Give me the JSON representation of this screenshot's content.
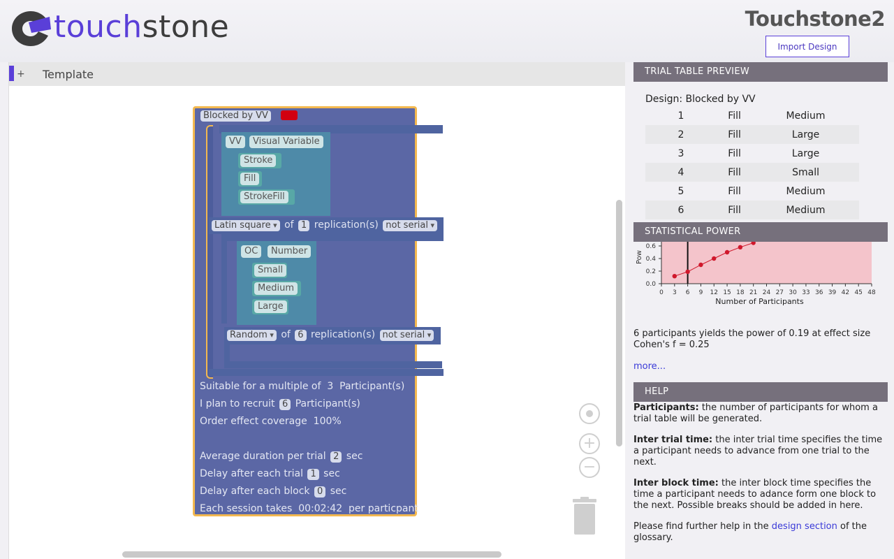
{
  "header": {
    "logo_text_a": "touch",
    "logo_text_b": "stone",
    "app_title": "Touchstone2",
    "import_button": "Import Design"
  },
  "workspace": {
    "tab_plus": "+",
    "tab_label": "Template"
  },
  "blocks": {
    "design_name": "Blocked by VV",
    "design_color": "#d10010",
    "factor1": {
      "id": "VV",
      "name": "Visual Variable",
      "levels": [
        "Stroke",
        "Fill",
        "StrokeFill"
      ]
    },
    "block1": {
      "order": "Latin square",
      "of_label": "of",
      "replications": "1",
      "replications_label": "replication(s)",
      "serial": "not serial"
    },
    "factor2": {
      "id": "OC",
      "name": "Number",
      "levels": [
        "Small",
        "Medium",
        "Large"
      ]
    },
    "block2": {
      "order": "Random",
      "of_label": "of",
      "replications": "6",
      "replications_label": "replication(s)",
      "serial": "not serial"
    },
    "summary": {
      "multiple_prefix": "Suitable for a multiple of",
      "multiple_value": "3",
      "multiple_suffix": "Participant(s)",
      "recruit_prefix": "I plan to recruit",
      "recruit_value": "6",
      "recruit_suffix": "Participant(s)",
      "coverage_label": "Order effect coverage",
      "coverage_value": "100%",
      "avg_prefix": "Average duration per trial",
      "avg_value": "2",
      "avg_suffix": "sec",
      "trial_delay_prefix": "Delay after each trial",
      "trial_delay_value": "1",
      "trial_delay_suffix": "sec",
      "block_delay_prefix": "Delay after each block",
      "block_delay_value": "0",
      "block_delay_suffix": "sec",
      "session_prefix": "Each session takes",
      "session_value": "00:02:42",
      "session_suffix": "per particpant"
    }
  },
  "trial_table": {
    "heading": "TRIAL TABLE PREVIEW",
    "design_label": "Design: Blocked by VV",
    "rows": [
      [
        "1",
        "Fill",
        "Medium"
      ],
      [
        "2",
        "Fill",
        "Large"
      ],
      [
        "3",
        "Fill",
        "Large"
      ],
      [
        "4",
        "Fill",
        "Small"
      ],
      [
        "5",
        "Fill",
        "Medium"
      ],
      [
        "6",
        "Fill",
        "Medium"
      ]
    ]
  },
  "power": {
    "heading": "STATISTICAL POWER",
    "ylabel": "Pow",
    "xlabel": "Number of Participants",
    "yticks": [
      "0.6",
      "0.4",
      "0.2",
      "0.0"
    ],
    "xticks": [
      "0",
      "3",
      "6",
      "9",
      "12",
      "15",
      "18",
      "21",
      "24",
      "27",
      "30",
      "33",
      "36",
      "39",
      "42",
      "45",
      "48"
    ],
    "marker_x": 6,
    "points": [
      [
        3,
        0.12
      ],
      [
        6,
        0.19
      ],
      [
        9,
        0.3
      ],
      [
        12,
        0.4
      ],
      [
        15,
        0.5
      ],
      [
        18,
        0.58
      ],
      [
        21,
        0.65
      ]
    ],
    "text_line1": "6 participants yields the power of 0.19 at effect size",
    "text_line2": "Cohen's f = 0.25",
    "more": "more..."
  },
  "help": {
    "heading": "HELP",
    "p1_bold": "Participants:",
    "p1_text": " the number of participants for whom a trial table will be generated.",
    "p2_bold": "Inter trial time:",
    "p2_text": " the inter trial time specifies the time a participant needs to advance from one trial to the next.",
    "p3_bold": "Inter block time:",
    "p3_text": " the inter block time specifies the time a participant needs to adance form one block to the next. Possible breaks should be added in here.",
    "p4_pre": "Please find further help in the ",
    "p4_link": "design section",
    "p4_post": " of the glossary."
  }
}
